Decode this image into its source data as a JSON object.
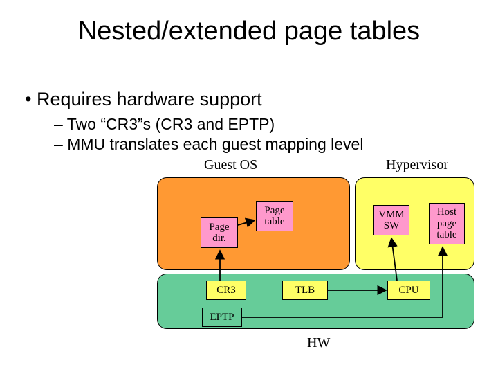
{
  "title": "Nested/extended page tables",
  "bullet_main": "Requires hardware support",
  "bullet_sub1": "Two “CR3”s (CR3 and EPTP)",
  "bullet_sub2": "MMU translates each guest mapping level",
  "labels": {
    "guest": "Guest OS",
    "hypervisor": "Hypervisor",
    "hw": "HW"
  },
  "boxes": {
    "page_dir": "Page\ndir.",
    "page_table": "Page\ntable",
    "vmm_sw": "VMM\nSW",
    "host_pt": "Host\npage\ntable",
    "cr3": "CR3",
    "tlb": "TLB",
    "cpu": "CPU",
    "eptp": "EPTP"
  }
}
